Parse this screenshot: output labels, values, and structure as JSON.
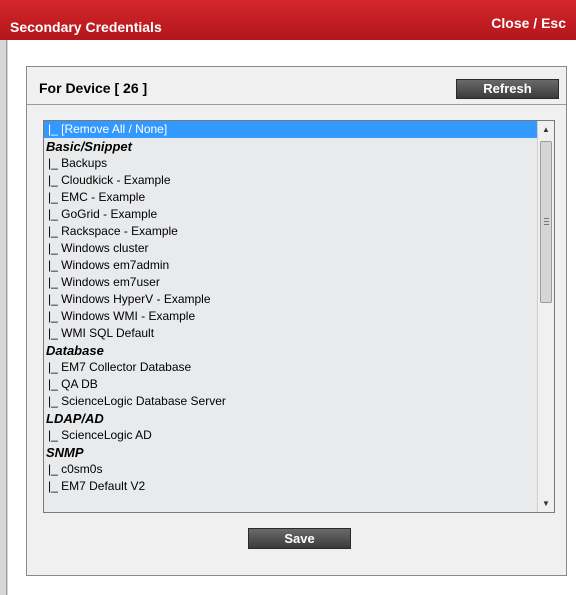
{
  "dialog": {
    "title": "Secondary Credentials",
    "close_label": "Close / Esc"
  },
  "panel": {
    "header_label": "For Device [ 26 ]",
    "refresh_label": "Refresh",
    "save_label": "Save"
  },
  "list": {
    "remove_all": "|_ [Remove All / None]",
    "groups": [
      {
        "name": "Basic/Snippet",
        "items": [
          "|_ Backups",
          "|_ Cloudkick - Example",
          "|_ EMC - Example",
          "|_ GoGrid - Example",
          "|_ Rackspace - Example",
          "|_ Windows cluster",
          "|_ Windows em7admin",
          "|_ Windows em7user",
          "|_ Windows HyperV - Example",
          "|_ Windows WMI - Example",
          "|_ WMI SQL Default"
        ]
      },
      {
        "name": "Database",
        "items": [
          "|_ EM7 Collector Database",
          "|_ QA DB",
          "|_ ScienceLogic Database Server"
        ]
      },
      {
        "name": "LDAP/AD",
        "items": [
          "|_ ScienceLogic AD"
        ]
      },
      {
        "name": "SNMP",
        "items": [
          "|_ c0sm0s",
          "|_ EM7 Default V2"
        ]
      }
    ]
  },
  "colors": {
    "titlebar": "#c41e24",
    "selection": "#3399ff",
    "button": "#4a4a4a"
  }
}
